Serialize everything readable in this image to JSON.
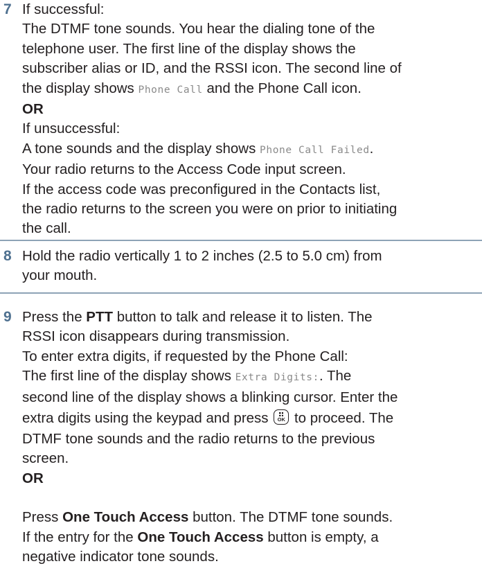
{
  "step7": {
    "number": "7",
    "l1": "If successful:",
    "l2": "The DTMF tone sounds. You hear the dialing tone of the",
    "l3": "telephone user. The first line of the display shows the",
    "l4": "subscriber alias or ID, and the RSSI icon. The second line of",
    "l5_a": "the display shows ",
    "l5_mono": "Phone Call",
    "l5_b": " and the Phone Call icon.",
    "or": "OR",
    "l7": "If unsuccessful:",
    "l8_a": "A tone sounds and the display shows ",
    "l8_mono": "Phone Call Failed",
    "l8_b": ".",
    "l9": "Your radio returns to the Access Code input screen.",
    "l10": "If the access code was preconfigured in the Contacts list,",
    "l11": "the radio returns to the screen you were on prior to initiating",
    "l12": "the call."
  },
  "step8": {
    "number": "8",
    "l1": "Hold the radio vertically 1 to 2 inches (2.5 to 5.0 cm) from",
    "l2": "your mouth."
  },
  "step9": {
    "number": "9",
    "l1_a": "Press the ",
    "l1_b": "PTT",
    "l1_c": " button to talk and release it to listen. The",
    "l2": "RSSI icon disappears during transmission.",
    "l3": "To enter extra digits, if requested by the Phone Call:",
    "l4_a": "The first line of the display shows ",
    "l4_mono": "Extra Digits:",
    "l4_b": ". The",
    "l5": "second line of the display shows a blinking cursor. Enter the",
    "l6_a": "extra digits using the keypad and press ",
    "ok_key_icon": "menu-ok-key-icon",
    "ok_key_text": "OK",
    "l6_b": " to proceed. The",
    "l7": "DTMF tone sounds and the radio returns to the previous",
    "l8": "screen.",
    "or": "OR",
    "l10_a": "Press ",
    "l10_b": "One Touch Access",
    "l10_c": " button. The DTMF tone sounds.",
    "l11_a": "If the entry for the ",
    "l11_b": "One Touch Access",
    "l11_c": " button is empty, a",
    "l12": "negative indicator tone sounds."
  },
  "colors": {
    "step_number": "#4f7190",
    "rule": "#8da3b6",
    "mono_text": "#8a8a8a",
    "body_text": "#231f20"
  }
}
